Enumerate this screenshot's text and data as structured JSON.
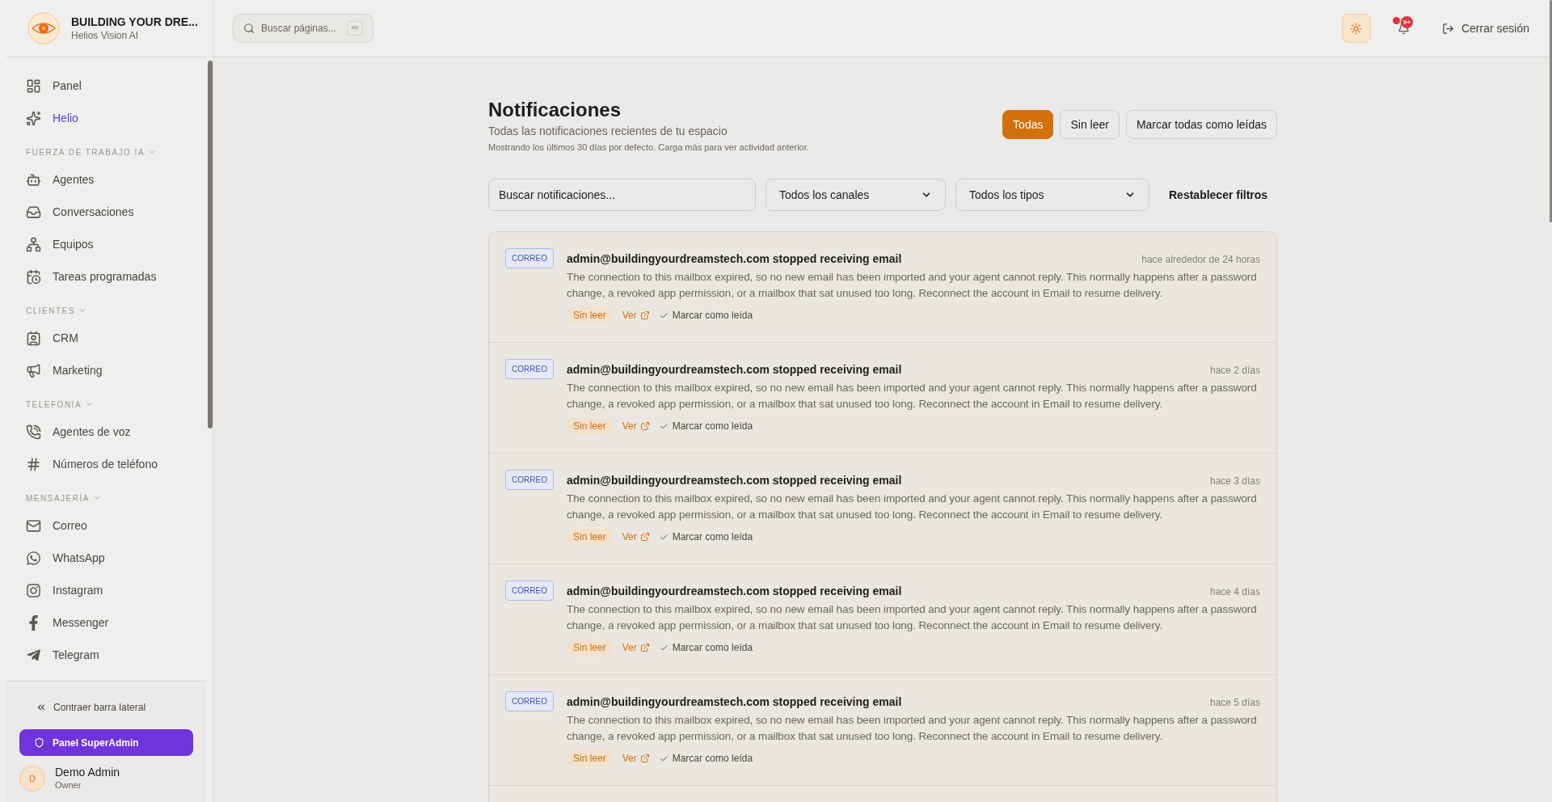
{
  "brand": {
    "name": "BUILDING YOUR DRE...",
    "subtitle": "Helios Vision AI"
  },
  "search": {
    "placeholder": "Buscar páginas...",
    "shortcut": "⌘K"
  },
  "header": {
    "notifications_badge": "9+",
    "logout": "Cerrar sesión"
  },
  "sidebar": {
    "items": [
      {
        "kind": "item",
        "label": "Panel",
        "selected": false
      },
      {
        "kind": "item",
        "label": "Helio",
        "selected": true
      },
      {
        "kind": "section",
        "label": "FUERZA DE TRABAJO IA",
        "expanded": true
      },
      {
        "kind": "item",
        "label": "Agentes",
        "selected": false
      },
      {
        "kind": "item",
        "label": "Conversaciones",
        "selected": false
      },
      {
        "kind": "item",
        "label": "Equipos",
        "selected": false
      },
      {
        "kind": "item",
        "label": "Tareas programadas",
        "selected": false
      },
      {
        "kind": "section",
        "label": "CLIENTES",
        "expanded": true
      },
      {
        "kind": "item",
        "label": "CRM",
        "selected": false
      },
      {
        "kind": "item",
        "label": "Marketing",
        "selected": false
      },
      {
        "kind": "section",
        "label": "TELEFONÍA",
        "expanded": true
      },
      {
        "kind": "item",
        "label": "Agentes de voz",
        "selected": false
      },
      {
        "kind": "item",
        "label": "Números de teléfono",
        "selected": false
      },
      {
        "kind": "section",
        "label": "MENSAJERÍA",
        "expanded": true
      },
      {
        "kind": "item",
        "label": "Correo",
        "selected": false
      },
      {
        "kind": "item",
        "label": "WhatsApp",
        "selected": false
      },
      {
        "kind": "item",
        "label": "Instagram",
        "selected": false
      },
      {
        "kind": "item",
        "label": "Messenger",
        "selected": false
      },
      {
        "kind": "item",
        "label": "Telegram",
        "selected": false
      }
    ],
    "collapse": "Contraer barra lateral",
    "superadmin": "Panel SuperAdmin",
    "user": {
      "initial": "D",
      "name": "Demo Admin",
      "role": "Owner"
    }
  },
  "page": {
    "title": "Notificaciones",
    "subtitle": "Todas las notificaciones recientes de tu espacio",
    "note": "Mostrando los últimos 30 días por defecto. Carga más para ver actividad anterior.",
    "filters": [
      {
        "label": "Todas",
        "selected": true
      },
      {
        "label": "Sin leer",
        "selected": false
      }
    ],
    "mark_all": "Marcar todas como leídas",
    "search_placeholder": "Buscar notificaciones...",
    "channel_select": "Todos los canales",
    "type_select": "Todos los tipos",
    "reset": "Restablecer filtros"
  },
  "notifications": [
    {
      "channel": "CORREO",
      "title": "admin@buildingyourdreamstech.com stopped receiving email",
      "time": "hace alrededor de 24 horas",
      "body": "The connection to this mailbox expired, so no new email has been imported and your agent cannot reply. This normally happens after a password change, a revoked app permission, or a mailbox that sat unused too long. Reconnect the account in Email to resume delivery.",
      "status": "Sin leer",
      "link": "Ver",
      "action": "Marcar como leída"
    },
    {
      "channel": "CORREO",
      "title": "admin@buildingyourdreamstech.com stopped receiving email",
      "time": "hace 2 días",
      "body": "The connection to this mailbox expired, so no new email has been imported and your agent cannot reply. This normally happens after a password change, a revoked app permission, or a mailbox that sat unused too long. Reconnect the account in Email to resume delivery.",
      "status": "Sin leer",
      "link": "Ver",
      "action": "Marcar como leída"
    },
    {
      "channel": "CORREO",
      "title": "admin@buildingyourdreamstech.com stopped receiving email",
      "time": "hace 3 días",
      "body": "The connection to this mailbox expired, so no new email has been imported and your agent cannot reply. This normally happens after a password change, a revoked app permission, or a mailbox that sat unused too long. Reconnect the account in Email to resume delivery.",
      "status": "Sin leer",
      "link": "Ver",
      "action": "Marcar como leída"
    },
    {
      "channel": "CORREO",
      "title": "admin@buildingyourdreamstech.com stopped receiving email",
      "time": "hace 4 días",
      "body": "The connection to this mailbox expired, so no new email has been imported and your agent cannot reply. This normally happens after a password change, a revoked app permission, or a mailbox that sat unused too long. Reconnect the account in Email to resume delivery.",
      "status": "Sin leer",
      "link": "Ver",
      "action": "Marcar como leída"
    },
    {
      "channel": "CORREO",
      "title": "admin@buildingyourdreamstech.com stopped receiving email",
      "time": "hace 5 días",
      "body": "The connection to this mailbox expired, so no new email has been imported and your agent cannot reply. This normally happens after a password change, a revoked app permission, or a mailbox that sat unused too long. Reconnect the account in Email to resume delivery.",
      "status": "Sin leer",
      "link": "Ver",
      "action": "Marcar como leída"
    }
  ]
}
